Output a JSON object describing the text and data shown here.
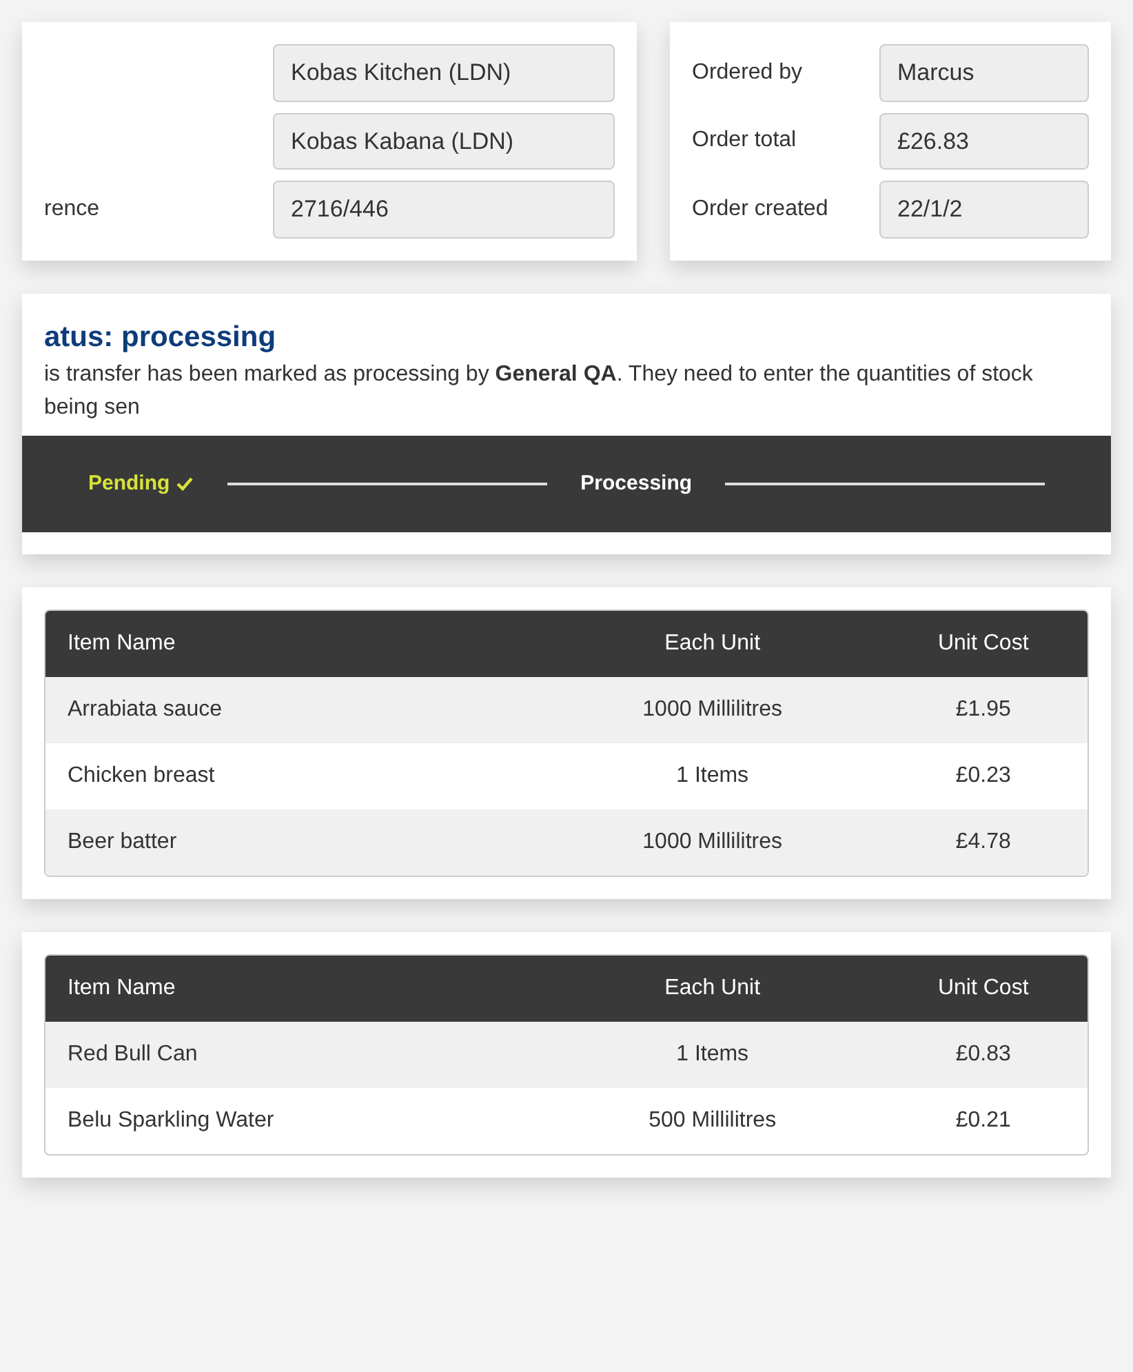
{
  "details_card": {
    "fields": [
      {
        "value": "Kobas Kitchen (LDN)"
      },
      {
        "value": "Kobas Kabana (LDN)"
      },
      {
        "label": "rence",
        "value": "2716/446"
      }
    ]
  },
  "order_card": {
    "fields": [
      {
        "label": "Ordered by",
        "value": "Marcus"
      },
      {
        "label": "Order total",
        "value": "£26.83"
      },
      {
        "label": "Order created",
        "value": "22/1/2"
      }
    ]
  },
  "status": {
    "heading": "atus: processing",
    "message": "is transfer has been marked as processing by **General QA**. They need to enter the quantities of stock being sen",
    "steps": [
      {
        "label": "Pending",
        "done": true,
        "selected": false
      },
      {
        "label": "Processing",
        "done": false,
        "selected": true
      }
    ]
  },
  "tables": [
    {
      "columns": [
        "Item Name",
        "Each Unit",
        "Unit Cost"
      ],
      "rows": [
        [
          "Arrabiata sauce",
          "1000 Millilitres",
          "£1.95"
        ],
        [
          "Chicken breast",
          "1 Items",
          "£0.23"
        ],
        [
          "Beer batter",
          "1000 Millilitres",
          "£4.78"
        ]
      ]
    },
    {
      "columns": [
        "Item Name",
        "Each Unit",
        "Unit Cost"
      ],
      "rows": [
        [
          "Red Bull Can",
          "1 Items",
          "£0.83"
        ],
        [
          "Belu Sparkling Water",
          "500 Millilitres",
          "£0.21"
        ]
      ]
    }
  ]
}
